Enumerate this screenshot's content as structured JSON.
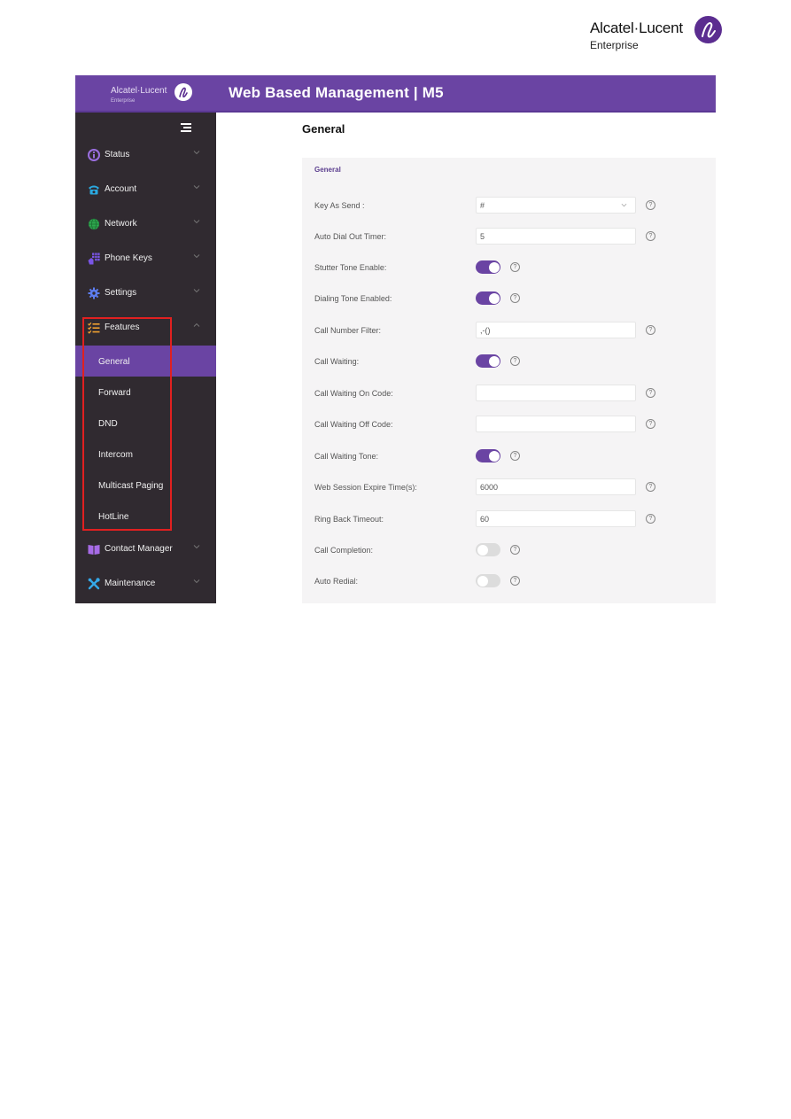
{
  "brand": {
    "name": "Alcatel·Lucent",
    "sub": "Enterprise"
  },
  "app": {
    "logo_name": "Alcatel·Lucent",
    "logo_sub": "Enterprise",
    "title": "Web Based Management | M5"
  },
  "sidebar": {
    "items": [
      {
        "label": "Status",
        "icon": "info-circle-icon",
        "color": "#9b6fe0",
        "expanded": false
      },
      {
        "label": "Account",
        "icon": "telephone-icon",
        "color": "#2aa9e0",
        "expanded": false
      },
      {
        "label": "Network",
        "icon": "globe-icon",
        "color": "#2fa84f",
        "expanded": false
      },
      {
        "label": "Phone Keys",
        "icon": "keypad-icon",
        "color": "#7a55e6",
        "expanded": false
      },
      {
        "label": "Settings",
        "icon": "gear-icon",
        "color": "#5d7df0",
        "expanded": false
      },
      {
        "label": "Features",
        "icon": "checklist-icon",
        "color": "#f0a030",
        "expanded": true
      },
      {
        "label": "Contact Manager",
        "icon": "book-icon",
        "color": "#a76be6",
        "expanded": false
      },
      {
        "label": "Maintenance",
        "icon": "tools-icon",
        "color": "#35a8e8",
        "expanded": false
      }
    ],
    "features_submenu": [
      {
        "label": "General",
        "active": true
      },
      {
        "label": "Forward",
        "active": false
      },
      {
        "label": "DND",
        "active": false
      },
      {
        "label": "Intercom",
        "active": false
      },
      {
        "label": "Multicast Paging",
        "active": false
      },
      {
        "label": "HotLine",
        "active": false
      }
    ]
  },
  "main": {
    "page_title": "General",
    "panel_title": "General",
    "rows": [
      {
        "label": "Key As Send :",
        "type": "select",
        "value": "#"
      },
      {
        "label": "Auto Dial Out Timer:",
        "type": "input",
        "value": "5"
      },
      {
        "label": "Stutter Tone Enable:",
        "type": "toggle",
        "value": true
      },
      {
        "label": "Dialing Tone Enabled:",
        "type": "toggle",
        "value": true
      },
      {
        "label": "Call Number Filter:",
        "type": "input",
        "value": ",-()"
      },
      {
        "label": "Call Waiting:",
        "type": "toggle",
        "value": true
      },
      {
        "label": "Call Waiting On Code:",
        "type": "input",
        "value": ""
      },
      {
        "label": "Call Waiting Off Code:",
        "type": "input",
        "value": ""
      },
      {
        "label": "Call Waiting Tone:",
        "type": "toggle",
        "value": true
      },
      {
        "label": "Web Session Expire Time(s):",
        "type": "input",
        "value": "6000"
      },
      {
        "label": "Ring Back Timeout:",
        "type": "input",
        "value": "60"
      },
      {
        "label": "Call Completion:",
        "type": "toggle",
        "value": false
      },
      {
        "label": "Auto Redial:",
        "type": "toggle",
        "value": false
      }
    ],
    "help_glyph": "?"
  },
  "colors": {
    "accent": "#6a44a3",
    "sidebar_bg": "#302a30",
    "highlight": "#e02020"
  }
}
